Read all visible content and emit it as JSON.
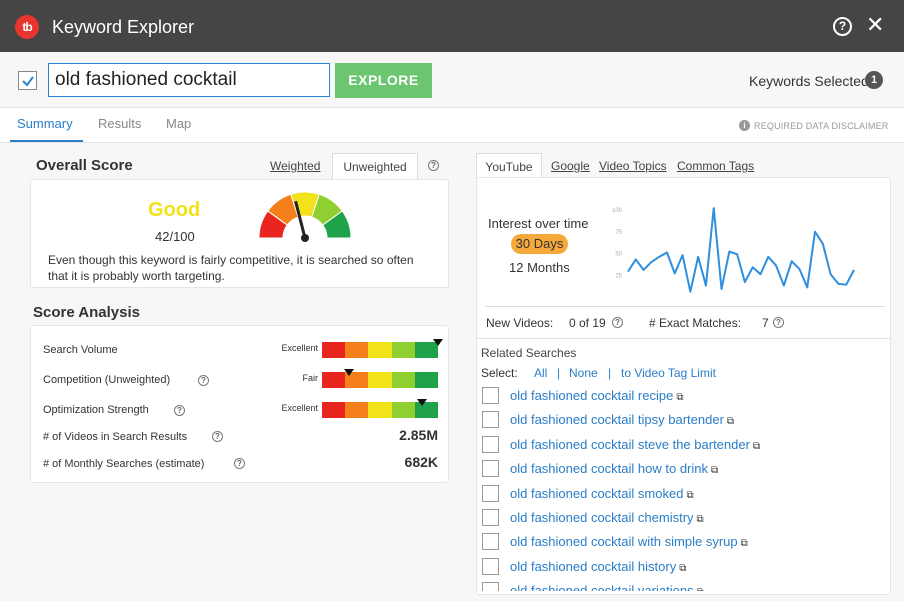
{
  "app": {
    "logo_text": "tb",
    "title": "Keyword Explorer"
  },
  "toolbar": {
    "search_value": "old fashioned cocktail",
    "explore_label": "EXPLORE",
    "keywords_selected_label": "Keywords Selected",
    "keywords_selected_count": "1"
  },
  "tabs": [
    "Summary",
    "Results",
    "Map"
  ],
  "disclaimer": "REQUIRED DATA DISCLAIMER",
  "overall": {
    "title": "Overall Score",
    "weighted": "Weighted",
    "unweighted": "Unweighted",
    "rating": "Good",
    "score": "42/100",
    "description": "Even though this keyword is fairly competitive, it is searched so often that it is probably worth targeting.",
    "rating_color": "#f2e21a"
  },
  "score_analysis": {
    "title": "Score Analysis",
    "rows": [
      {
        "label": "Search Volume",
        "level": "Excellent",
        "position": 1.0
      },
      {
        "label": "Competition (Unweighted)",
        "level": "Fair",
        "position": 0.23
      },
      {
        "label": "Optimization Strength",
        "level": "Excellent",
        "position": 0.86
      }
    ],
    "stats": [
      {
        "label": "# of Videos in Search Results",
        "value": "2.85M"
      },
      {
        "label": "# of Monthly Searches (estimate)",
        "value": "682K"
      }
    ],
    "meter_colors": [
      "#e8261f",
      "#f47f1b",
      "#f2e21a",
      "#8fcf2f",
      "#1fa34a"
    ]
  },
  "right": {
    "tabs": [
      "YouTube",
      "Google",
      "Video Topics",
      "Common Tags"
    ],
    "interest_label": "Interest over time",
    "range_active": "30 Days",
    "range_other": "12 Months",
    "new_videos_label": "New Videos:",
    "new_videos_value": "0 of 19",
    "exact_label": "# Exact Matches:",
    "exact_value": "7",
    "related_title": "Related Searches",
    "select_label": "Select:",
    "select_all": "All",
    "select_none": "None",
    "select_limit": "to Video Tag Limit",
    "related": [
      "old fashioned cocktail recipe",
      "old fashioned cocktail tipsy bartender",
      "old fashioned cocktail steve the bartender",
      "old fashioned cocktail how to drink",
      "old fashioned cocktail smoked",
      "old fashioned cocktail chemistry",
      "old fashioned cocktail with simple syrup",
      "old fashioned cocktail history",
      "old fashioned cocktail variations"
    ]
  },
  "chart_data": {
    "type": "line",
    "yticks": [
      "100",
      "75",
      "50",
      "25"
    ],
    "ylim": [
      0,
      100
    ],
    "series": [
      {
        "values": [
          28,
          42,
          30,
          39,
          45,
          50,
          26,
          47,
          5,
          45,
          12,
          101,
          8,
          51,
          48,
          16,
          33,
          25,
          45,
          35,
          12,
          40,
          31,
          10,
          74,
          60,
          25,
          14,
          13,
          30
        ]
      }
    ],
    "color": "#2e8fde"
  }
}
